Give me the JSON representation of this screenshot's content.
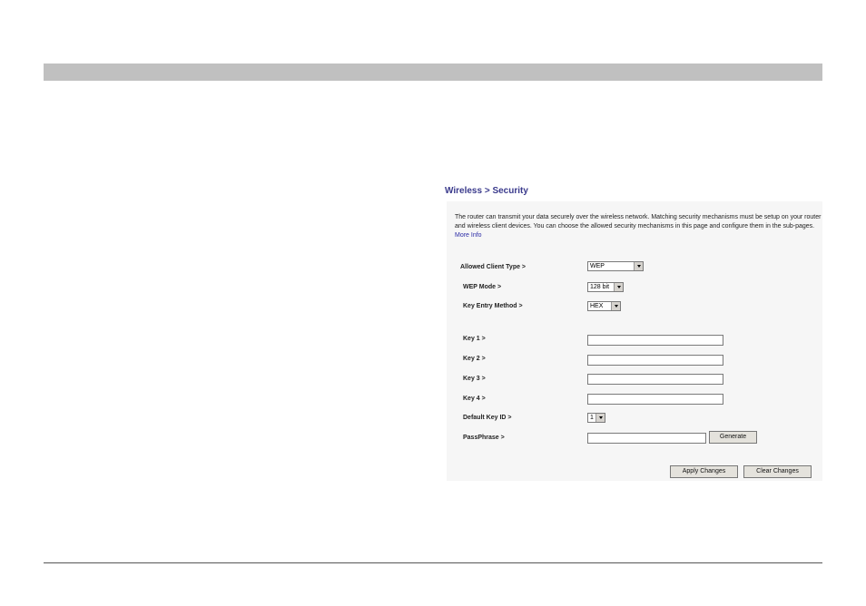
{
  "page": {
    "title": "Wireless > Security",
    "description": "The router can transmit your data securely over the wireless network. Matching security mechanisms must be setup on your router and wireless client devices. You can choose the allowed security mechanisms in this page and configure them in the sub-pages.",
    "more_info": "More Info"
  },
  "form": {
    "client_type_label": "Allowed Client Type >",
    "client_type_value": "WEP",
    "wep_mode_label": "WEP Mode >",
    "wep_mode_value": "128 bit",
    "key_method_label": "Key Entry Method >",
    "key_method_value": "HEX",
    "key1_label": "Key 1 >",
    "key2_label": "Key 2 >",
    "key3_label": "Key 3 >",
    "key4_label": "Key 4 >",
    "key1_value": "",
    "key2_value": "",
    "key3_value": "",
    "key4_value": "",
    "default_key_label": "Default Key ID >",
    "default_key_value": "1",
    "passphrase_label": "PassPhrase >",
    "passphrase_value": "",
    "generate_label": "Generate"
  },
  "actions": {
    "apply_label": "Apply Changes",
    "clear_label": "Clear Changes"
  },
  "colors": {
    "top_bar": "#c0c0c0",
    "title": "#3a3a8c",
    "link": "#2b2ba6",
    "panel": "#f6f6f6"
  }
}
